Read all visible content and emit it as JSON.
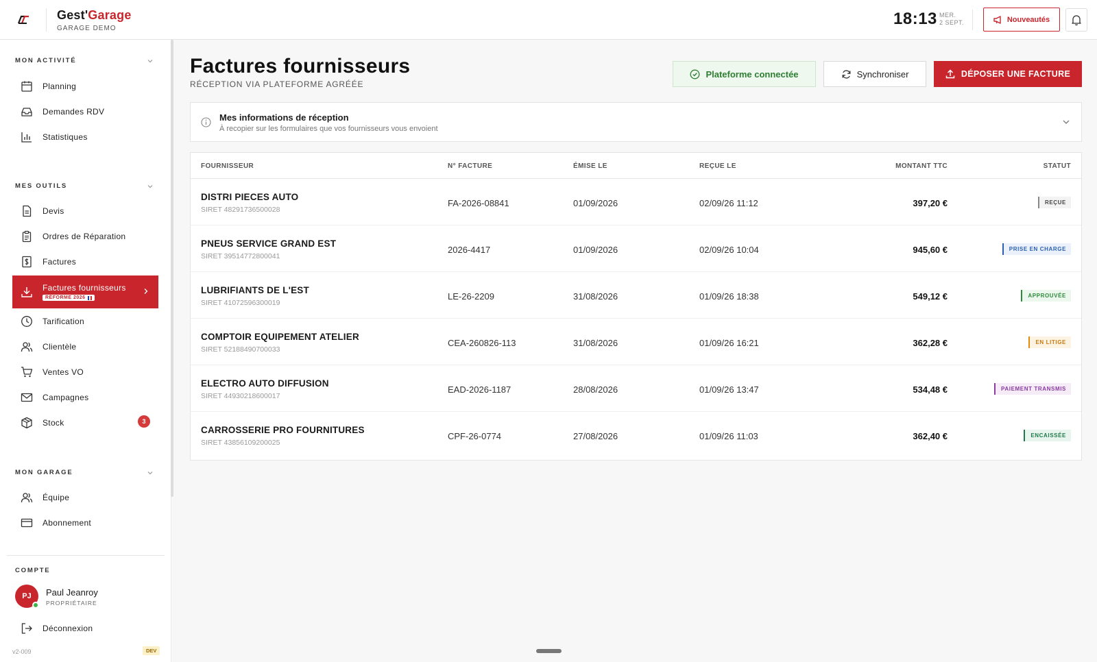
{
  "brand": {
    "name_part1": "Gest'",
    "name_part2": "Garage",
    "subtitle": "GARAGE DEMO",
    "logo_text": "GG"
  },
  "header": {
    "time": "18:13",
    "date_day": "MER.",
    "date_date": "2 SEPT.",
    "news_label": "Nouveautés"
  },
  "sidebar": {
    "sections": [
      {
        "title": "MON ACTIVITÉ"
      },
      {
        "title": "MES OUTILS"
      },
      {
        "title": "MON GARAGE"
      }
    ],
    "activity": [
      {
        "label": "Planning",
        "icon": "calendar-icon"
      },
      {
        "label": "Demandes RDV",
        "icon": "inbox-icon"
      },
      {
        "label": "Statistiques",
        "icon": "bar-chart-icon"
      }
    ],
    "tools": [
      {
        "label": "Devis",
        "icon": "document-icon"
      },
      {
        "label": "Ordres de Réparation",
        "icon": "clipboard-icon"
      },
      {
        "label": "Factures",
        "icon": "dollar-document-icon"
      },
      {
        "label": "Factures fournisseurs",
        "icon": "download-icon",
        "badge": "RÉFORME 2026",
        "active": true
      },
      {
        "label": "Tarification",
        "icon": "clock-icon"
      },
      {
        "label": "Clientèle",
        "icon": "users-icon"
      },
      {
        "label": "Ventes VO",
        "icon": "cart-icon"
      },
      {
        "label": "Campagnes",
        "icon": "mail-icon"
      },
      {
        "label": "Stock",
        "icon": "box-icon",
        "count": "3"
      }
    ],
    "garage": [
      {
        "label": "Équipe",
        "icon": "users-icon"
      },
      {
        "label": "Abonnement",
        "icon": "credit-card-icon"
      }
    ],
    "account": {
      "title": "COMPTE",
      "initials": "PJ",
      "name": "Paul Jeanroy",
      "role": "PROPRIÉTAIRE",
      "logout": "Déconnexion"
    },
    "version": "v2-009",
    "env": "DEV"
  },
  "main": {
    "title": "Factures fournisseurs",
    "subtitle": "RÉCEPTION VIA PLATEFORME AGRÉÉE",
    "connected_label": "Plateforme connectée",
    "sync_label": "Synchroniser",
    "upload_label": "DÉPOSER UNE FACTURE",
    "info": {
      "title": "Mes informations de réception",
      "subtitle": "À recopier sur les formulaires que vos fournisseurs vous envoient"
    },
    "columns": [
      "FOURNISSEUR",
      "N° FACTURE",
      "ÉMISE LE",
      "REÇUE LE",
      "MONTANT TTC",
      "STATUT"
    ],
    "rows": [
      {
        "supplier": "DISTRI PIECES AUTO",
        "siret": "SIRET 48291736500028",
        "invoice": "FA-2026-08841",
        "issued": "01/09/2026",
        "received": "02/09/26 11:12",
        "amount": "397,20 €",
        "status": "REÇUE",
        "status_class": "st-recue"
      },
      {
        "supplier": "PNEUS SERVICE GRAND EST",
        "siret": "SIRET 39514772800041",
        "invoice": "2026-4417",
        "issued": "01/09/2026",
        "received": "02/09/26 10:04",
        "amount": "945,60 €",
        "status": "PRISE EN CHARGE",
        "status_class": "st-prise"
      },
      {
        "supplier": "LUBRIFIANTS DE L'EST",
        "siret": "SIRET 41072596300019",
        "invoice": "LE-26-2209",
        "issued": "31/08/2026",
        "received": "01/09/26 18:38",
        "amount": "549,12 €",
        "status": "APPROUVÉE",
        "status_class": "st-appr"
      },
      {
        "supplier": "COMPTOIR EQUIPEMENT ATELIER",
        "siret": "SIRET 52188490700033",
        "invoice": "CEA-260826-113",
        "issued": "31/08/2026",
        "received": "01/09/26 16:21",
        "amount": "362,28 €",
        "status": "EN LITIGE",
        "status_class": "st-litige"
      },
      {
        "supplier": "ELECTRO AUTO DIFFUSION",
        "siret": "SIRET 44930218600017",
        "invoice": "EAD-2026-1187",
        "issued": "28/08/2026",
        "received": "01/09/26 13:47",
        "amount": "534,48 €",
        "status": "PAIEMENT TRANSMIS",
        "status_class": "st-paie"
      },
      {
        "supplier": "CARROSSERIE PRO FOURNITURES",
        "siret": "SIRET 43856109200025",
        "invoice": "CPF-26-0774",
        "issued": "27/08/2026",
        "received": "01/09/26 11:03",
        "amount": "362,40 €",
        "status": "ENCAISSÉE",
        "status_class": "st-enc"
      }
    ]
  },
  "colors": {
    "accent": "#c8262c",
    "success": "#2e7d32"
  }
}
